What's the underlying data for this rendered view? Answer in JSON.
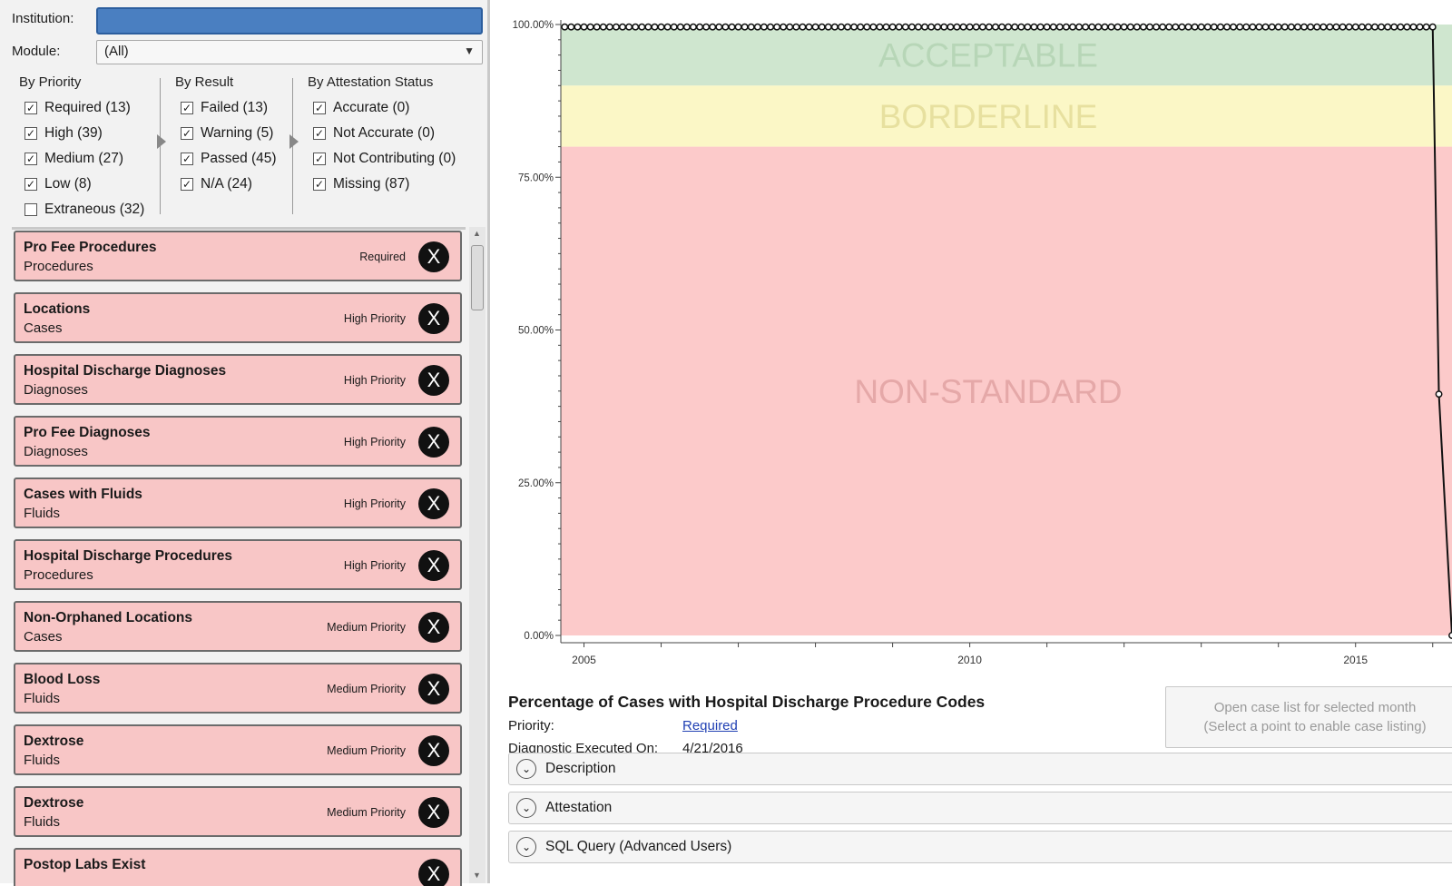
{
  "header": {
    "institution_label": "Institution:",
    "institution_value": "",
    "module_label": "Module:",
    "module_value": "(All)"
  },
  "filters": {
    "by_priority": {
      "title": "By Priority",
      "items": [
        {
          "label": "Required (13)",
          "checked": true
        },
        {
          "label": "High (39)",
          "checked": true
        },
        {
          "label": "Medium (27)",
          "checked": true
        },
        {
          "label": "Low (8)",
          "checked": true
        },
        {
          "label": "Extraneous (32)",
          "checked": false
        }
      ]
    },
    "by_result": {
      "title": "By Result",
      "items": [
        {
          "label": "Failed (13)",
          "checked": true
        },
        {
          "label": "Warning (5)",
          "checked": true
        },
        {
          "label": "Passed (45)",
          "checked": true
        },
        {
          "label": "N/A (24)",
          "checked": true
        }
      ]
    },
    "by_attestation": {
      "title": "By Attestation Status",
      "items": [
        {
          "label": "Accurate (0)",
          "checked": true
        },
        {
          "label": "Not Accurate (0)",
          "checked": true
        },
        {
          "label": "Not Contributing (0)",
          "checked": true
        },
        {
          "label": "Missing (87)",
          "checked": true
        }
      ]
    }
  },
  "diagnostics": [
    {
      "title": "Pro Fee Procedures",
      "module": "Procedures",
      "priority": "Required"
    },
    {
      "title": "Locations",
      "module": "Cases",
      "priority": "High Priority"
    },
    {
      "title": "Hospital Discharge Diagnoses",
      "module": "Diagnoses",
      "priority": "High Priority"
    },
    {
      "title": "Pro Fee Diagnoses",
      "module": "Diagnoses",
      "priority": "High Priority"
    },
    {
      "title": "Cases with Fluids",
      "module": "Fluids",
      "priority": "High Priority"
    },
    {
      "title": "Hospital Discharge Procedures",
      "module": "Procedures",
      "priority": "High Priority"
    },
    {
      "title": "Non-Orphaned Locations",
      "module": "Cases",
      "priority": "Medium Priority"
    },
    {
      "title": "Blood Loss",
      "module": "Fluids",
      "priority": "Medium Priority"
    },
    {
      "title": "Dextrose",
      "module": "Fluids",
      "priority": "Medium Priority"
    },
    {
      "title": "Dextrose",
      "module": "Fluids",
      "priority": "Medium Priority"
    },
    {
      "title": "Postop Labs Exist",
      "module": "",
      "priority": ""
    }
  ],
  "close_glyph": "X",
  "chart_data": {
    "type": "line",
    "ylim": [
      0,
      100
    ],
    "y_ticks": [
      "100.00%",
      "75.00%",
      "50.00%",
      "25.00%",
      "0.00%"
    ],
    "x_ticks": [
      "2005",
      "2010",
      "2015"
    ],
    "xlim": [
      2004.7,
      2016.25
    ],
    "bands": [
      {
        "label": "ACCEPTABLE",
        "from": 90,
        "to": 100,
        "color": "#cfe6cf",
        "text_color": "#b7d6b7"
      },
      {
        "label": "BORDERLINE",
        "from": 80,
        "to": 90,
        "color": "#fbf7c6",
        "text_color": "#e7e09f"
      },
      {
        "label": "NON-STANDARD",
        "from": 0,
        "to": 80,
        "color": "#fccaca",
        "text_color": "#e5a8a8"
      }
    ],
    "series": [
      {
        "x_start": 2004.75,
        "x_end": 2016.0,
        "value": 99.6,
        "drop_points": [
          [
            2016.08,
            39.5
          ],
          [
            2016.25,
            0
          ]
        ]
      }
    ]
  },
  "details": {
    "title": "Percentage of Cases with Hospital Discharge Procedure Codes",
    "priority_label": "Priority:",
    "priority_value": "Required",
    "executed_label": "Diagnostic Executed On:",
    "executed_value": "4/21/2016",
    "case_button_line1": "Open case list for selected month",
    "case_button_line2": "(Select a point to enable case listing)",
    "sections": [
      "Description",
      "Attestation",
      "SQL Query (Advanced Users)"
    ]
  }
}
